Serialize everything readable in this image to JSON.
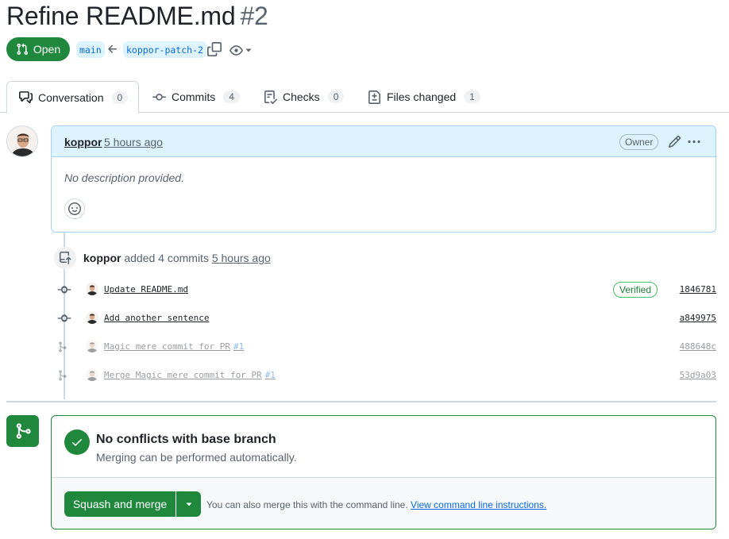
{
  "pr": {
    "title": "Refine README.md",
    "number": "#2",
    "state": "Open",
    "base_branch": "main",
    "head_branch": "koppor-patch-2"
  },
  "tabs": [
    {
      "label": "Conversation",
      "count": "0",
      "icon": "comment-discussion-icon"
    },
    {
      "label": "Commits",
      "count": "4",
      "icon": "git-commit-icon"
    },
    {
      "label": "Checks",
      "count": "0",
      "icon": "checklist-icon"
    },
    {
      "label": "Files changed",
      "count": "1",
      "icon": "file-diff-icon"
    }
  ],
  "comment": {
    "author": "koppor",
    "time": "5 hours ago",
    "role_badge": "Owner",
    "body": "No description provided."
  },
  "timeline_event": {
    "actor": "koppor",
    "action": "added 4 commits",
    "time": "5 hours ago"
  },
  "commits": [
    {
      "message": "Update README.md",
      "pr_ref": "",
      "sha": "1846781",
      "verified": "Verified"
    },
    {
      "message": "Add another sentence",
      "pr_ref": "",
      "sha": "a849975",
      "verified": ""
    },
    {
      "message": "Magic mere commit for PR",
      "pr_ref": "#1",
      "sha": "488648c",
      "verified": ""
    },
    {
      "message": "Merge Magic mere commit for PR",
      "pr_ref": "#1",
      "sha": "53d9a03",
      "verified": ""
    }
  ],
  "merge": {
    "title": "No conflicts with base branch",
    "subtitle": "Merging can be performed automatically.",
    "button_label": "Squash and merge",
    "note": "You can also merge this with the command line.",
    "link": "View command line instructions."
  },
  "colors": {
    "success": "#1f883d",
    "accent": "#0969da",
    "comment_header": "#ddf4ff"
  }
}
